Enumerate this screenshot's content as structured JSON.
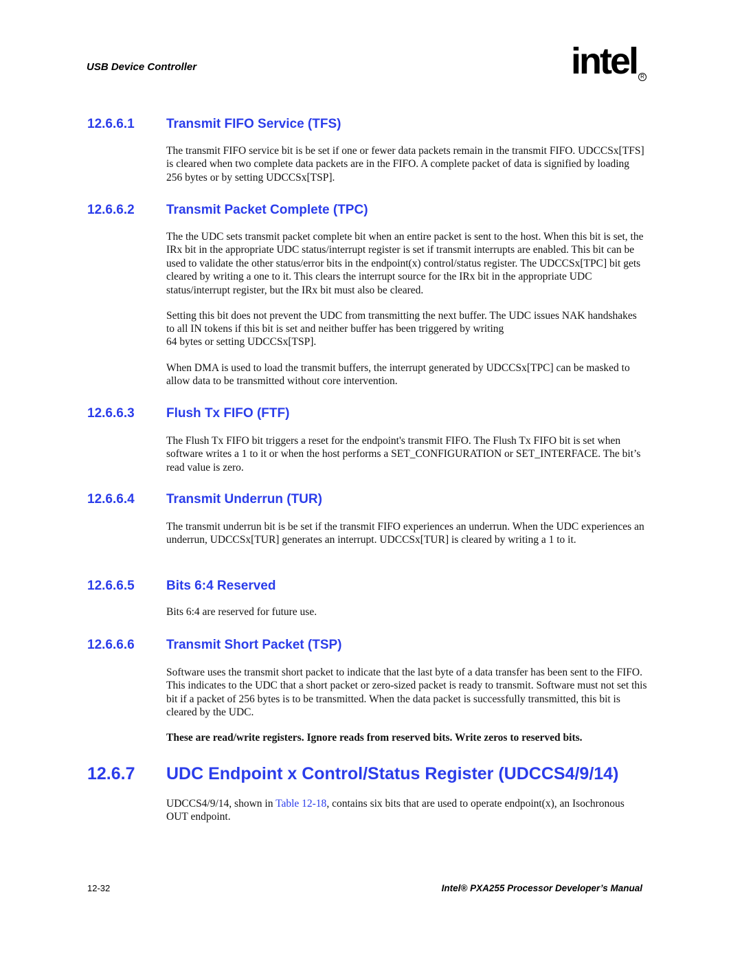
{
  "header": {
    "running_title": "USB Device Controller",
    "logo": {
      "wordmark": "intel",
      "registered": "R",
      "icon": "intel-logo"
    }
  },
  "sections": [
    {
      "number": "12.6.6.1",
      "title": "Transmit FIFO Service (TFS)",
      "paragraphs": [
        "The transmit FIFO service bit is be set if one or fewer data packets remain in the transmit FIFO. UDCCSx[TFS] is cleared when two complete data packets are in the FIFO. A complete packet of data is signified by loading 256 bytes or by setting UDCCSx[TSP]."
      ]
    },
    {
      "number": "12.6.6.2",
      "title": "Transmit Packet Complete (TPC)",
      "paragraphs": [
        "The the UDC sets transmit packet complete bit when an entire packet is sent to the host. When this bit is set, the IRx bit in the appropriate UDC status/interrupt register is set if transmit interrupts are enabled. This bit can be used to validate the other status/error bits in the endpoint(x) control/status register. The UDCCSx[TPC] bit gets cleared by writing a one to it. This clears the interrupt source for the IRx bit in the appropriate UDC status/interrupt register, but the IRx bit must also be cleared.",
        "Setting this bit does not prevent the UDC from transmitting the next buffer. The UDC issues NAK handshakes to all IN tokens if this bit is set and neither buffer has been triggered by writing",
        "64 bytes or setting UDCCSx[TSP].",
        "When DMA is used to load the transmit buffers, the interrupt generated by UDCCSx[TPC] can be masked to allow data to be transmitted without core intervention."
      ]
    },
    {
      "number": "12.6.6.3",
      "title": "Flush Tx FIFO (FTF)",
      "paragraphs": [
        "The Flush Tx FIFO bit triggers a reset for the endpoint's transmit FIFO. The Flush Tx FIFO bit is set when software writes a 1 to it or when the host performs a SET_CONFIGURATION or SET_INTERFACE. The bit’s read value is zero."
      ]
    },
    {
      "number": "12.6.6.4",
      "title": "Transmit Underrun (TUR)",
      "paragraphs": [
        "The transmit underrun bit is be set if the transmit FIFO experiences an underrun. When the UDC experiences an underrun, UDCCSx[TUR] generates an interrupt. UDCCSx[TUR] is cleared by writing a 1 to it."
      ]
    },
    {
      "number": "12.6.6.5",
      "title": "Bits 6:4 Reserved",
      "paragraphs": [
        "Bits 6:4 are reserved for future use."
      ]
    },
    {
      "number": "12.6.6.6",
      "title": "Transmit Short Packet (TSP)",
      "paragraphs": [
        "Software uses the transmit short packet to indicate that the last byte of a data transfer has been sent to the FIFO. This indicates to the UDC that a short packet or zero-sized packet is ready to transmit. Software must not set this bit if a packet of 256 bytes is to be transmitted. When the data packet is successfully transmitted, this bit is cleared by the UDC.",
        "These are read/write registers. Ignore reads from reserved bits. Write zeros to reserved bits."
      ]
    },
    {
      "number": "12.6.7",
      "title": "UDC Endpoint x Control/Status Register (UDCCS4/9/14)",
      "paragraphs": [
        {
          "before": "UDCCS4/9/14, shown in ",
          "link": "Table 12-18",
          "after": ", contains six bits that are used to operate endpoint(x), an Isochronous OUT endpoint."
        }
      ]
    }
  ],
  "footer": {
    "page_number": "12-32",
    "manual_title": "Intel® PXA255 Processor Developer’s Manual"
  }
}
